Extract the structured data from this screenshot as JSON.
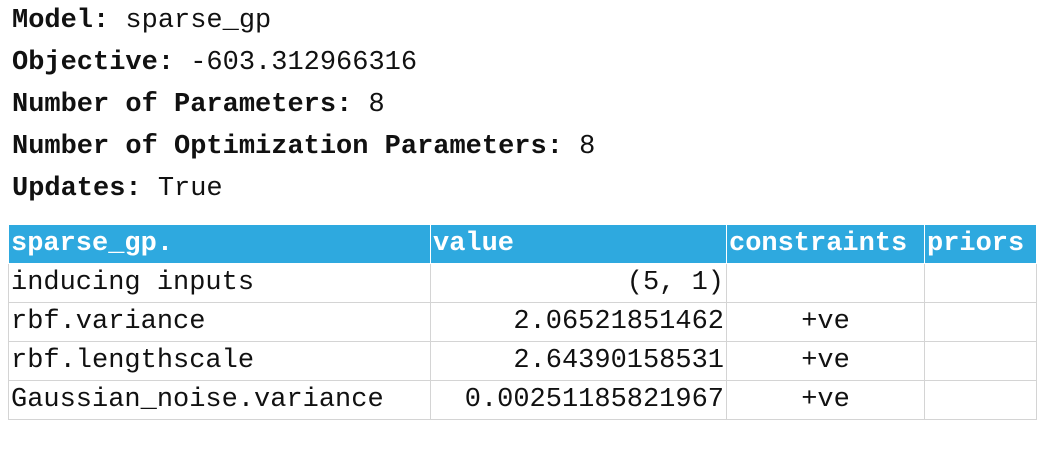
{
  "summary": {
    "model_label": "Model",
    "model_value": "sparse_gp",
    "objective_label": "Objective",
    "objective_value": "-603.312966316",
    "num_params_label": "Number of Parameters",
    "num_params_value": "8",
    "num_opt_params_label": "Number of Optimization Parameters",
    "num_opt_params_value": "8",
    "updates_label": "Updates",
    "updates_value": "True"
  },
  "table": {
    "headers": [
      "sparse_gp.",
      "value",
      "constraints",
      "priors"
    ],
    "rows": [
      {
        "name": "inducing inputs",
        "value": "(5, 1)",
        "constraints": "",
        "priors": ""
      },
      {
        "name": "rbf.variance",
        "value": "2.06521851462",
        "constraints": "+ve",
        "priors": ""
      },
      {
        "name": "rbf.lengthscale",
        "value": "2.64390158531",
        "constraints": "+ve",
        "priors": ""
      },
      {
        "name": "Gaussian_noise.variance",
        "value": "0.00251185821967",
        "constraints": "+ve",
        "priors": ""
      }
    ]
  },
  "colors": {
    "header_bg": "#2ea9df",
    "header_text": "#ffffff",
    "grid": "#d4d4d4"
  }
}
